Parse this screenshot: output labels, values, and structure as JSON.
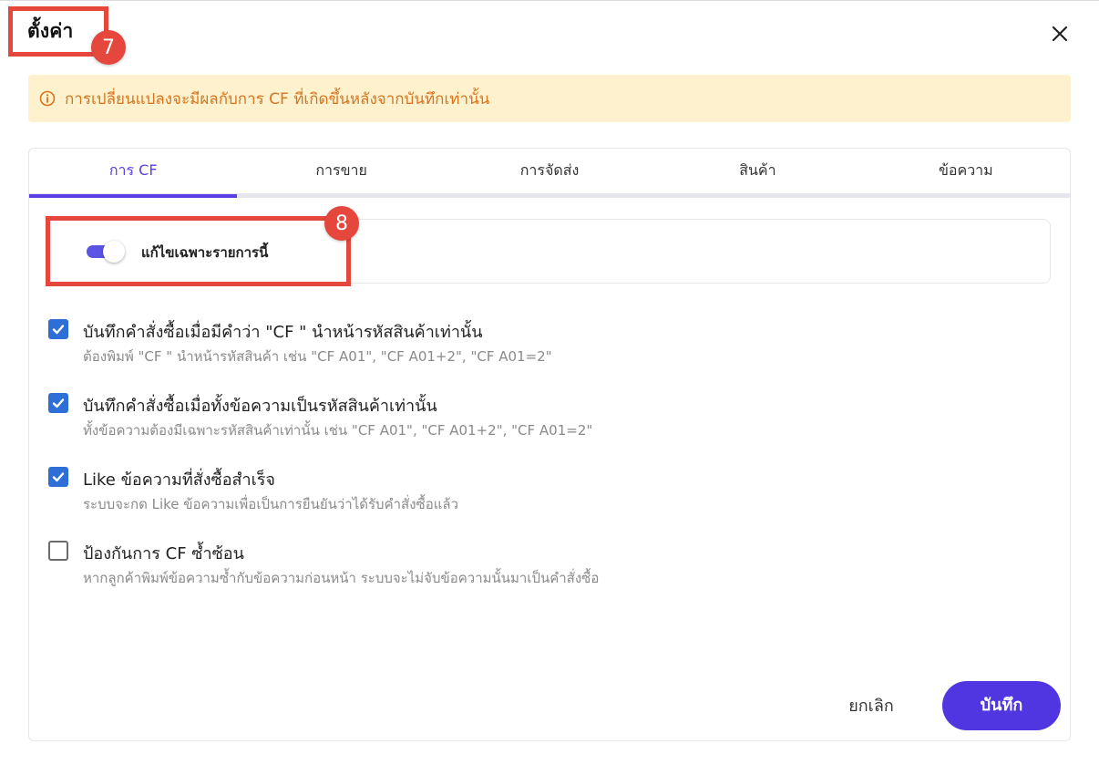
{
  "dialog": {
    "title": "ตั้งค่า"
  },
  "annotations": {
    "badge_1": "7",
    "badge_2": "8"
  },
  "notice": {
    "text": "การเปลี่ยนแปลงจะมีผลกับการ CF ที่เกิดขึ้นหลังจากบันทึกเท่านั้น",
    "color": "#d9731e",
    "background": "#fdf2cd"
  },
  "tabs": [
    {
      "label": "การ CF",
      "active": true
    },
    {
      "label": "การขาย",
      "active": false
    },
    {
      "label": "การจัดส่ง",
      "active": false
    },
    {
      "label": "สินค้า",
      "active": false
    },
    {
      "label": "ข้อความ",
      "active": false
    }
  ],
  "toggle": {
    "label": "แก้ไขเฉพาะรายการนี้",
    "on": true
  },
  "options": [
    {
      "title": "บันทึกคำสั่งซื้อเมื่อมีคำว่า \"CF \" นำหน้ารหัสสินค้าเท่านั้น",
      "desc": "ต้องพิมพ์ \"CF \" นำหน้ารหัสสินค้า เช่น \"CF A01\", \"CF A01+2\", \"CF A01=2\"",
      "checked": true
    },
    {
      "title": "บันทึกคำสั่งซื้อเมื่อทั้งข้อความเป็นรหัสสินค้าเท่านั้น",
      "desc": "ทั้งข้อความต้องมีเฉพาะรหัสสินค้าเท่านั้น เช่น \"CF A01\", \"CF A01+2\", \"CF A01=2\"",
      "checked": true
    },
    {
      "title": "Like ข้อความที่สั่งซื้อสำเร็จ",
      "desc": "ระบบจะกด Like ข้อความเพื่อเป็นการยืนยันว่าได้รับคำสั่งซื้อแล้ว",
      "checked": true
    },
    {
      "title": "ป้องกันการ CF ซ้ำซ้อน",
      "desc": "หากลูกค้าพิมพ์ข้อความซ้ำกับข้อความก่อนหน้า ระบบจะไม่จับข้อความนั้นมาเป็นคำสั่งซื้อ",
      "checked": false
    }
  ],
  "buttons": {
    "cancel": "ยกเลิก",
    "save": "บันทึก"
  },
  "colors": {
    "accent": "#5b3ee4",
    "primary_button": "#4f36e0",
    "checkbox": "#2d6fd6",
    "highlight": "#e5473d"
  }
}
